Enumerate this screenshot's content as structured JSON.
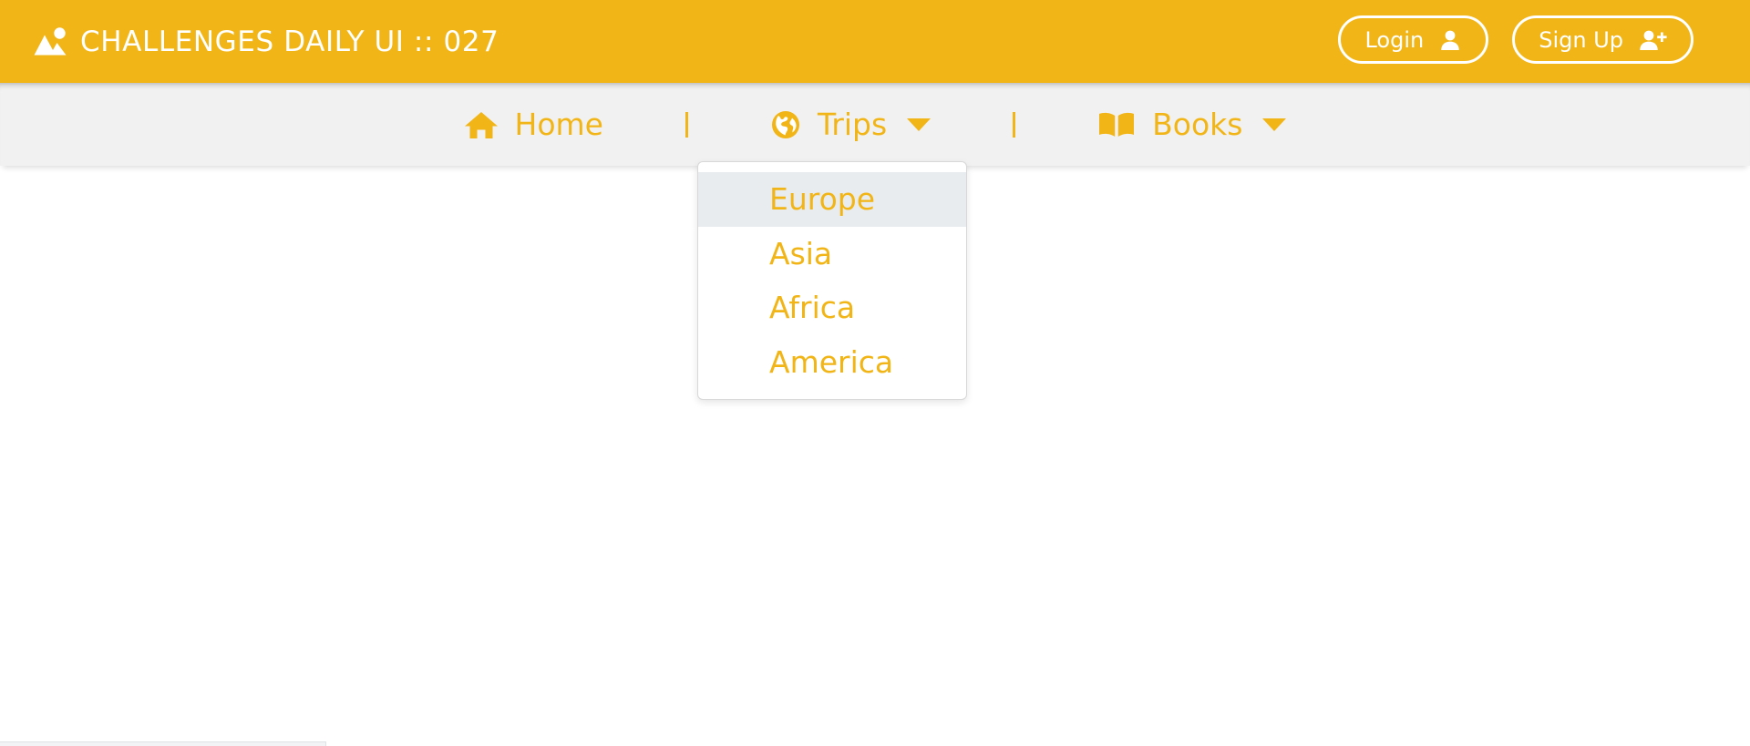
{
  "header": {
    "logo_icon": "image-mountain-icon",
    "title": "CHALLENGES DAILY UI :: 027",
    "background_color": "#f2b517",
    "text_color": "#ffffff",
    "auth": [
      {
        "label": "Login",
        "icon": "person-icon"
      },
      {
        "label": "Sign Up",
        "icon": "person-add-icon"
      }
    ]
  },
  "navbar": {
    "background_color": "#f1f1f1",
    "link_color": "#f2b517",
    "items": [
      {
        "label": "Home",
        "icon": "home-icon",
        "has_caret": false
      },
      {
        "label": "Trips",
        "icon": "globe-icon",
        "has_caret": true
      },
      {
        "label": "Books",
        "icon": "book-icon",
        "has_caret": true
      }
    ]
  },
  "dropdown": {
    "owner": "Trips",
    "open": true,
    "highlight_color": "#e9ecef",
    "items": [
      {
        "label": "Europe",
        "active": true
      },
      {
        "label": "Asia",
        "active": false
      },
      {
        "label": "Africa",
        "active": false
      },
      {
        "label": "America",
        "active": false
      }
    ]
  }
}
